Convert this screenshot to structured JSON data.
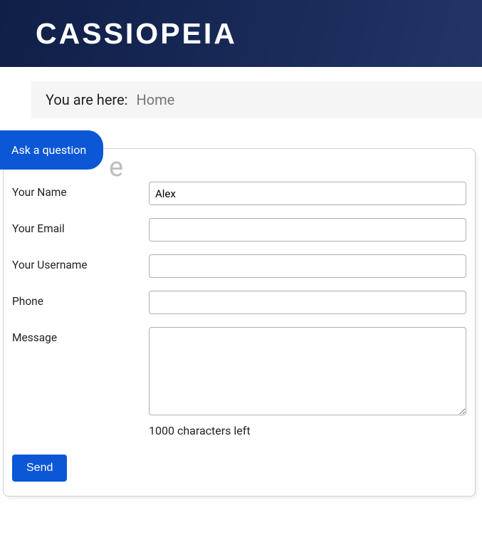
{
  "header": {
    "brand": "CASSIOPEIA"
  },
  "breadcrumb": {
    "prefix": "You are here:",
    "current": "Home"
  },
  "ask_tab": {
    "label": "Ask a question"
  },
  "page_title_fragment": "e",
  "form": {
    "fields": {
      "name": {
        "label": "Your Name",
        "value": "Alex"
      },
      "email": {
        "label": "Your Email",
        "value": ""
      },
      "username": {
        "label": "Your Username",
        "value": ""
      },
      "phone": {
        "label": "Phone",
        "value": ""
      },
      "message": {
        "label": "Message",
        "value": ""
      }
    },
    "char_count": "1000 characters left",
    "submit_label": "Send"
  }
}
